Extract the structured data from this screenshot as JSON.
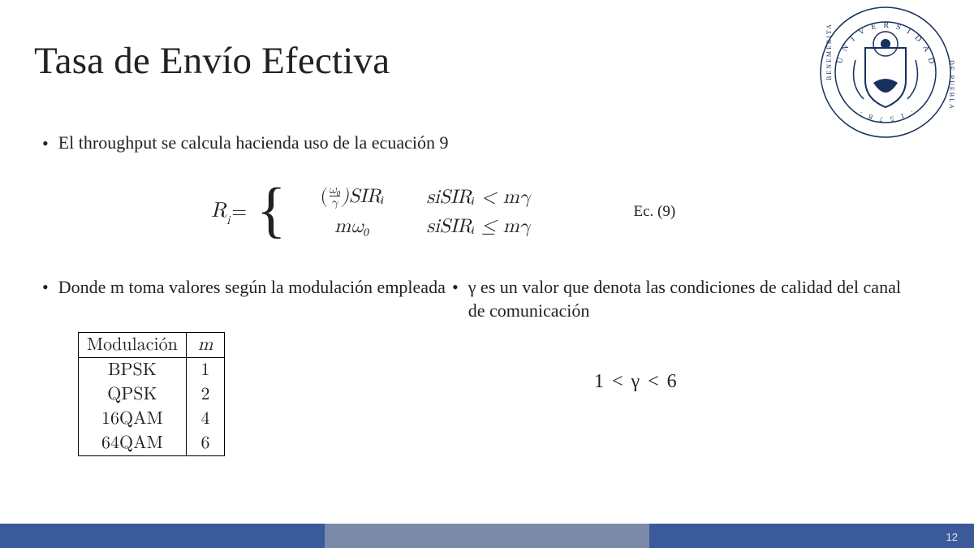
{
  "title": "Tasa de Envío Efectiva",
  "bullet_intro": "El throughput se calcula hacienda uso de la ecuación 9",
  "equation": {
    "lhs": "R",
    "lhs_sub": "i",
    "equals": " = ",
    "case1_expr_pre": "(",
    "case1_frac_num": "ω₀",
    "case1_frac_den": "γ",
    "case1_expr_post": ")SIRᵢ",
    "case1_cond": "siSIRᵢ < mγ",
    "case2_expr": "mω₀",
    "case2_cond": "siSIRᵢ ≤ mγ",
    "label": "Ec. (9)"
  },
  "left_bullet": "Donde m toma valores según la modulación empleada",
  "right_bullet": "γ  es un valor que denota las condiciones de calidad del canal de comunicación",
  "table": {
    "headers": [
      "Modulación",
      "m"
    ],
    "rows": [
      [
        "BPSK",
        "1"
      ],
      [
        "QPSK",
        "2"
      ],
      [
        "16QAM",
        "4"
      ],
      [
        "64QAM",
        "6"
      ]
    ]
  },
  "gamma_range": "1  <  γ  <  6",
  "page_number": "12",
  "logo_alt": "university-seal",
  "colors": {
    "footer_blue": "#3b5a9a",
    "footer_grey": "#7a8aa8",
    "seal_navy": "#17305c"
  }
}
